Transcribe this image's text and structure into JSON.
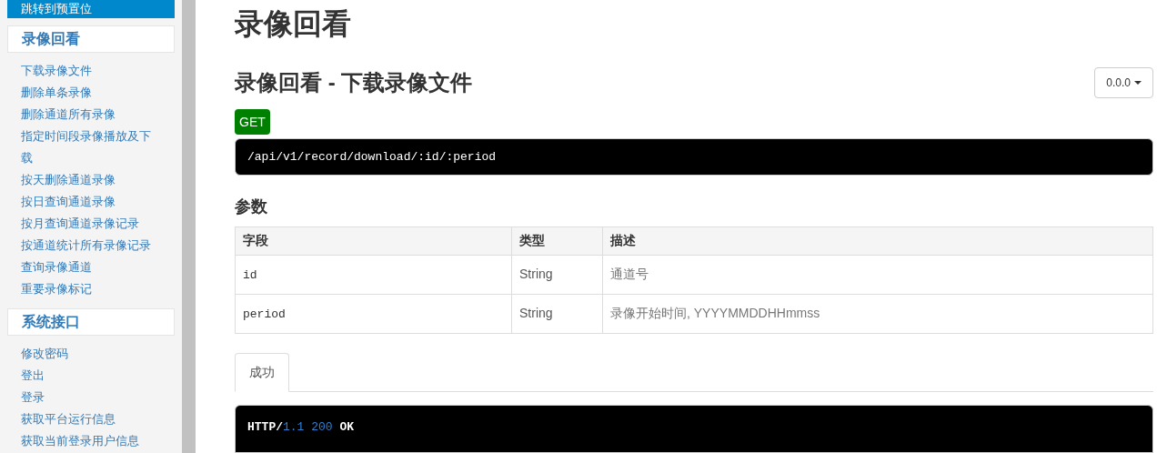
{
  "sidebar": {
    "current_item": {
      "label": "跳转到预置位",
      "selected": true
    },
    "sections": [
      {
        "title": "录像回看",
        "items": [
          {
            "label": "下载录像文件"
          },
          {
            "label": "删除单条录像"
          },
          {
            "label": "删除通道所有录像"
          },
          {
            "label": "指定时间段录像播放及下载"
          },
          {
            "label": "按天删除通道录像"
          },
          {
            "label": "按日查询通道录像"
          },
          {
            "label": "按月查询通道录像记录"
          },
          {
            "label": "按通道统计所有录像记录"
          },
          {
            "label": "查询录像通道"
          },
          {
            "label": "重要录像标记"
          }
        ]
      },
      {
        "title": "系统接口",
        "items": [
          {
            "label": "修改密码"
          },
          {
            "label": "登出"
          },
          {
            "label": "登录"
          },
          {
            "label": "获取平台运行信息"
          },
          {
            "label": "获取当前登录用户信息"
          }
        ]
      }
    ]
  },
  "main": {
    "title": "录像回看",
    "subtitle": "录像回看 - 下载录像文件",
    "version_button": "0.0.0",
    "method": "GET",
    "endpoint": "/api/v1/record/download/:id/:period",
    "params_heading": "参数",
    "table": {
      "columns": [
        "字段",
        "类型",
        "描述"
      ],
      "rows": [
        [
          "id",
          "String",
          "通道号"
        ],
        [
          "period",
          "String",
          "录像开始时间, YYYYMMDDHHmmss"
        ]
      ]
    },
    "tabs": [
      {
        "label": "成功",
        "selected": true
      }
    ],
    "response_line": [
      {
        "text": "HTTP/",
        "kind": "plain"
      },
      {
        "text": "1.1 200",
        "kind": "number"
      },
      {
        "text": " OK",
        "kind": "plain"
      }
    ]
  }
}
